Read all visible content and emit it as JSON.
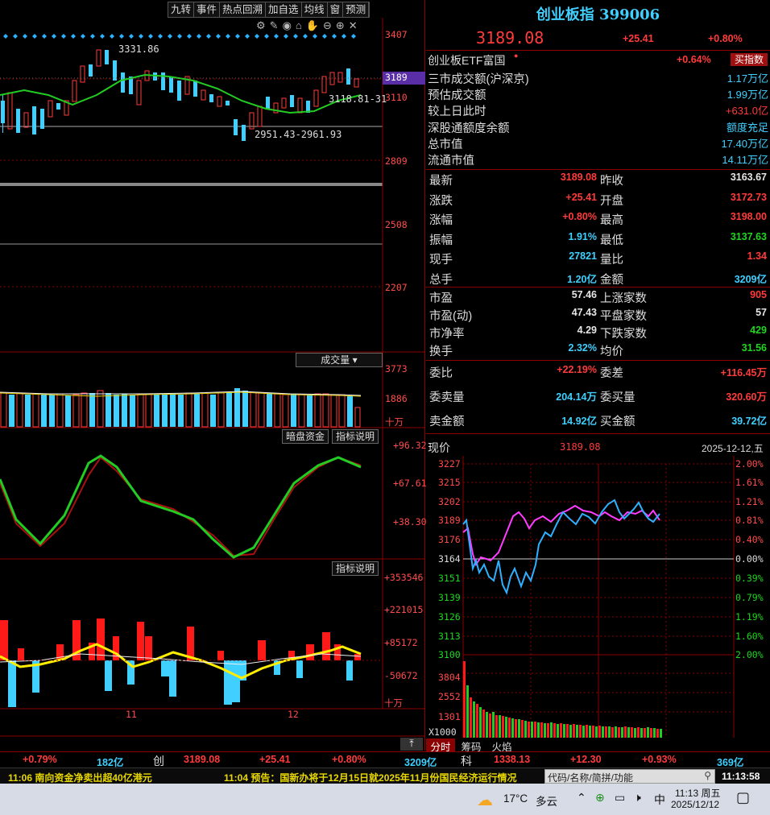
{
  "toolbar": [
    "九转",
    "事件",
    "热点回溯",
    "加自选",
    "均线",
    "窗",
    "预测"
  ],
  "index": {
    "title": "创业板指 399006",
    "price": "3189.08",
    "change": "+25.41",
    "pct": "+0.80%"
  },
  "etf": {
    "name": "创业板ETF富国",
    "pct": "+0.64%",
    "button": "买指数"
  },
  "info": [
    {
      "k": "三市成交额(沪深京)",
      "v": "1.17万亿",
      "c": "cyan"
    },
    {
      "k": "预估成交额",
      "v": "1.99万亿",
      "c": "cyan"
    },
    {
      "k": "较上日此时",
      "v": "+631.0亿",
      "c": "red"
    },
    {
      "k": "深股通额度余额",
      "v": "额度充足",
      "c": "cyan"
    },
    {
      "k": "总市值",
      "v": "17.40万亿",
      "c": "cyan"
    },
    {
      "k": "流通市值",
      "v": "14.11万亿",
      "c": "cyan"
    }
  ],
  "quote": [
    {
      "k1": "最新",
      "v1": "3189.08",
      "c1": "red",
      "k2": "昨收",
      "v2": "3163.67",
      "c2": "white"
    },
    {
      "k1": "涨跌",
      "v1": "+25.41",
      "c1": "red",
      "k2": "开盘",
      "v2": "3172.73",
      "c2": "red"
    },
    {
      "k1": "涨幅",
      "v1": "+0.80%",
      "c1": "red",
      "k2": "最高",
      "v2": "3198.00",
      "c2": "red"
    },
    {
      "k1": "振幅",
      "v1": "1.91%",
      "c1": "cyan",
      "k2": "最低",
      "v2": "3137.63",
      "c2": "green"
    },
    {
      "k1": "现手",
      "v1": "27821",
      "c1": "cyan",
      "k2": "量比",
      "v2": "1.34",
      "c2": "red"
    },
    {
      "k1": "总手",
      "v1": "1.20亿",
      "c1": "cyan",
      "k2": "金额",
      "v2": "3209亿",
      "c2": "cyan"
    }
  ],
  "quote2": [
    {
      "k1": "市盈",
      "v1": "57.46",
      "c1": "white",
      "k2": "上涨家数",
      "v2": "905",
      "c2": "red"
    },
    {
      "k1": "市盈(动)",
      "v1": "47.43",
      "c1": "white",
      "k2": "平盘家数",
      "v2": "57",
      "c2": "white"
    },
    {
      "k1": "市净率",
      "v1": "4.29",
      "c1": "white",
      "k2": "下跌家数",
      "v2": "429",
      "c2": "green"
    },
    {
      "k1": "换手",
      "v1": "2.32%",
      "c1": "cyan",
      "k2": "均价",
      "v2": "31.56",
      "c2": "green"
    }
  ],
  "quote3": [
    {
      "k1": "委比",
      "v1": "+22.19%",
      "c1": "red",
      "k2": "委差",
      "v2": "+116.45万",
      "c2": "red"
    },
    {
      "k1": "委卖量",
      "v1": "204.14万",
      "c1": "cyan",
      "k2": "委买量",
      "v2": "320.60万",
      "c2": "red"
    },
    {
      "k1": "卖金额",
      "v1": "14.92亿",
      "c1": "cyan",
      "k2": "买金额",
      "v2": "39.72亿",
      "c2": "cyan"
    }
  ],
  "intraday": {
    "label": "现价",
    "price": "3189.08",
    "date": "2025-12-12,五",
    "left_ticks": [
      "3227",
      "3215",
      "3202",
      "3189",
      "3176",
      "3164",
      "3151",
      "3139",
      "3126",
      "3113",
      "3100"
    ],
    "right_ticks": [
      "2.00%",
      "1.61%",
      "1.21%",
      "0.81%",
      "0.40%",
      "0.00%",
      "0.39%",
      "0.79%",
      "1.19%",
      "1.60%",
      "2.00%"
    ],
    "vol_ticks": [
      "3804",
      "2552",
      "1301",
      "X1000"
    ],
    "tabs": [
      "分时",
      "筹码",
      "火焰"
    ]
  },
  "kline": {
    "y_ticks": [
      "3407",
      "3189",
      "3110",
      "2809",
      "2508",
      "2207"
    ],
    "high_label": "3331.86",
    "low_label": "2951.43-2961.93",
    "ma_label": "3118.81-31"
  },
  "volume": {
    "label": "成交量",
    "ticks": [
      "3773",
      "1886",
      "十万"
    ]
  },
  "osc": {
    "btn1": "暗盘资金",
    "btn2": "指标说明",
    "ticks": [
      "+96.32",
      "+67.61",
      "+38.30"
    ]
  },
  "fund": {
    "btn": "指标说明",
    "ticks": [
      "+353546",
      "+221015",
      "+85172",
      "-50672",
      "十万"
    ],
    "dates": [
      "11",
      "12"
    ]
  },
  "status": {
    "pct1": "+0.79%",
    "amt1": "182亿",
    "name": "创",
    "price": "3189.08",
    "chg": "+25.41",
    "pct2": "+0.80%",
    "amt2": "3209亿",
    "name2": "科",
    "price2": "1338.13",
    "chg2": "+12.30",
    "pct3": "+0.93%",
    "amt3": "369亿"
  },
  "ticker": {
    "news1": "11:06 南向资金净卖出超40亿港元",
    "news2": "11:04 预告：国新办将于12月15日就2025年11月份国民经济运行情况",
    "search_placeholder": "代码/名称/简拼/功能",
    "clock": "11:13:58"
  },
  "taskbar": {
    "weather": "17°C",
    "weather_desc": "多云",
    "ime": "中",
    "time": "11:13 周五",
    "date": "2025/12/12"
  }
}
